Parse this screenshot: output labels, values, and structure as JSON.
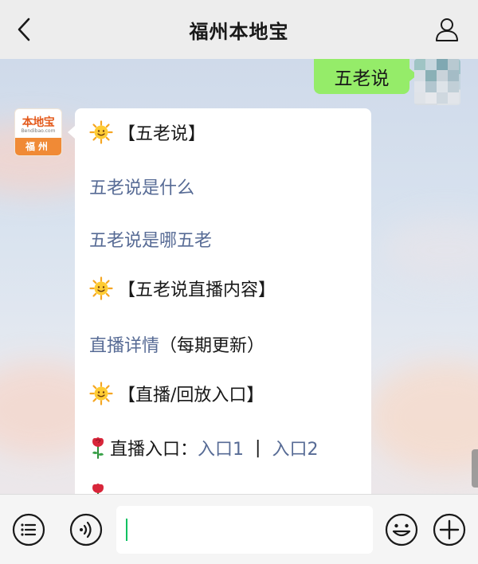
{
  "header": {
    "title": "福州本地宝",
    "back_icon": "chevron-left-icon",
    "profile_icon": "user-icon"
  },
  "sent_message": {
    "text": "五老说"
  },
  "bot_avatar": {
    "logo_text": "本地宝",
    "logo_sub": "Bendibao.com",
    "city": "福州"
  },
  "card": {
    "section1_title": "【五老说】",
    "link_what": "五老说是什么",
    "link_which": "五老说是哪五老",
    "section2_title": "【五老说直播内容】",
    "link_detail": "直播详情",
    "detail_note": "（每期更新）",
    "section3_title": "【直播/回放入口】",
    "live_label": "直播入口：",
    "entry1": "入口1",
    "separator": "|",
    "entry2": "入口2"
  },
  "bottom_bar": {
    "menu_icon": "list-menu-icon",
    "voice_icon": "voice-icon",
    "emoji_icon": "emoji-icon",
    "plus_icon": "plus-icon"
  },
  "colors": {
    "link": "#576b95",
    "sent_bubble": "#95ec69",
    "header_bg": "#ededed",
    "caret": "#07c160"
  }
}
